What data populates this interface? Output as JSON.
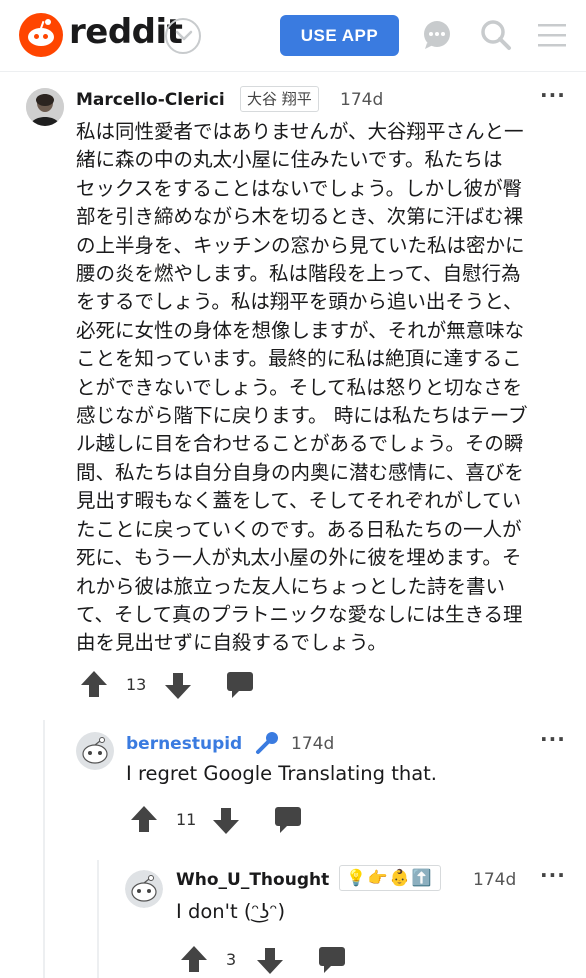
{
  "colors": {
    "brand": "#ff4500",
    "blue": "#3a7be0",
    "icon_gray": "#c8cbcd",
    "action_gray": "#444444"
  },
  "header": {
    "logo_text": "reddit",
    "use_app_label": "USE APP",
    "icons": [
      "snoo-logo-icon",
      "chevron-down-icon",
      "chat-icon",
      "search-icon",
      "menu-icon"
    ]
  },
  "comments": [
    {
      "username": "Marcello-Clerici",
      "flair": "大谷 翔平",
      "age": "174d",
      "lines": [
        "私は同性愛者ではありませんが、大谷翔平さんと一",
        "緒に森の中の丸太小屋に住みたいです。私たちは",
        "セックスをすることはないでしょう。しかし彼が臀",
        "部を引き締めながら木を切るとき、次第に汗ばむ裸",
        "の上半身を、キッチンの窓から見ていた私は密かに",
        "腰の炎を燃やします。私は階段を上って、自慰行為",
        "をするでしょう。私は翔平を頭から追い出そうと、",
        "必死に女性の身体を想像しますが、それが無意味な",
        "ことを知っています。最終的に私は絶頂に達するこ",
        "とができないでしょう。そして私は怒りと切なさを",
        "感じながら階下に戻ります。 時には私たちはテーブ",
        "ル越しに目を合わせることがあるでしょう。その瞬",
        "間、私たちは自分自身の内奥に潜む感情に、喜びを",
        "見出す暇もなく蓋をして、そしてそれぞれがしてい",
        "たことに戻っていくのです。ある日私たちの一人が",
        "死に、もう一人が丸太小屋の外に彼を埋めます。そ",
        "れから彼は旅立った友人にちょっとした詩を書い",
        "て、そして真のプラトニックな愛なしには生きる理",
        "由を見出せずに自殺するでしょう。"
      ],
      "score": "13"
    },
    {
      "username": "bernestupid",
      "flair_icon": "microphone-icon",
      "age": "174d",
      "text": "I regret Google Translating that.",
      "score": "11"
    },
    {
      "username": "Who_U_Thought",
      "flair_emojis": "💡👉👶⬆️",
      "age": "174d",
      "text": "I don't (ᵔ͜ʖᵔ)",
      "score": "3"
    }
  ]
}
